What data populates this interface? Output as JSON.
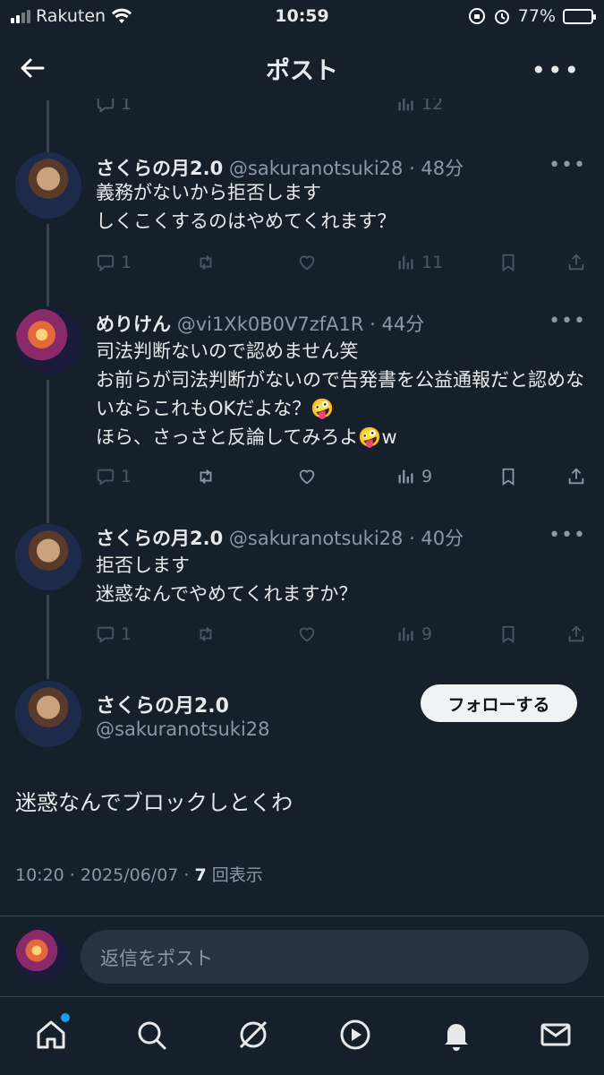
{
  "status_bar": {
    "carrier": "Rakuten",
    "time": "10:59",
    "battery": "77%",
    "battery_level": 0.77
  },
  "header": {
    "title": "ポスト"
  },
  "previous_actions": {
    "replies": "1",
    "views": "12"
  },
  "tweets": [
    {
      "name": "さくらの月2.0",
      "handle": "@sakuranotsuki28",
      "time": "· 48分",
      "text": "義務がないから拒否します\nしくこくするのはやめてくれます？",
      "replies": "1",
      "views": "11",
      "avatar": "anime-boy-avatar"
    },
    {
      "name": "めりけん",
      "handle": "@vi1Xk0B0V7zfA1R",
      "time": "· 44分",
      "text": "司法判断ないので認めません笑\nお前らが司法判断がないので告発書を公益通報だと認めないならこれもOKだよな？🤪\nほら、さっさと反論してみろよ🤪w",
      "replies": "1",
      "views": "9",
      "avatar": "fireworks-avatar"
    },
    {
      "name": "さくらの月2.0",
      "handle": "@sakuranotsuki28",
      "time": "· 40分",
      "text": "拒否します\n迷惑なんでやめてくれますか？",
      "replies": "1",
      "views": "9",
      "avatar": "anime-boy-avatar"
    }
  ],
  "main_post": {
    "name": "さくらの月2.0",
    "handle": "@sakuranotsuki28",
    "follow_label": "フォローする",
    "text": "迷惑なんでブロックしとくわ",
    "timestamp": "10:20 · 2025/06/07 · ",
    "view_count": "7",
    "view_label": " 回表示"
  },
  "reply": {
    "placeholder": "返信をポスト"
  },
  "tabs": [
    "home",
    "search",
    "grok",
    "video",
    "notifications",
    "messages"
  ],
  "colors": {
    "background": "#15202b",
    "secondary_text": "#8b98a5",
    "accent": "#1d9bf0"
  }
}
